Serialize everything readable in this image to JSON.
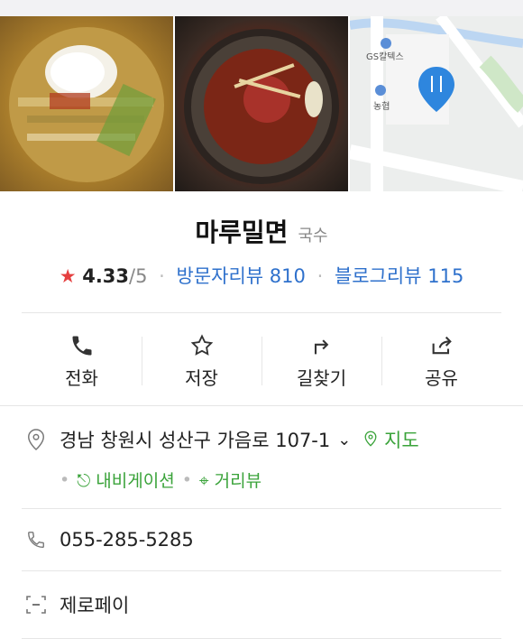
{
  "header": {
    "title": "마루밀면",
    "category": "국수"
  },
  "rating": {
    "score": "4.33",
    "outof": "/5",
    "visitor_reviews": "방문자리뷰 810",
    "blog_reviews": "블로그리뷰 115"
  },
  "map": {
    "labels": [
      "GS칼텍스",
      "농협"
    ]
  },
  "actions": [
    {
      "label": "전화",
      "icon": "phone-icon"
    },
    {
      "label": "저장",
      "icon": "star-outline-icon"
    },
    {
      "label": "길찾기",
      "icon": "directions-icon"
    },
    {
      "label": "공유",
      "icon": "share-icon"
    }
  ],
  "address": {
    "text": "경남 창원시 성산구 가음로 107-1",
    "map_link": "지도",
    "navigation": "내비게이션",
    "street_view": "거리뷰"
  },
  "phone": {
    "number": "055-285-5285"
  },
  "payment": {
    "label": "제로페이"
  },
  "colors": {
    "accent_blue": "#2f71cc",
    "accent_green": "#3aa33a",
    "star_red": "#e54040"
  }
}
